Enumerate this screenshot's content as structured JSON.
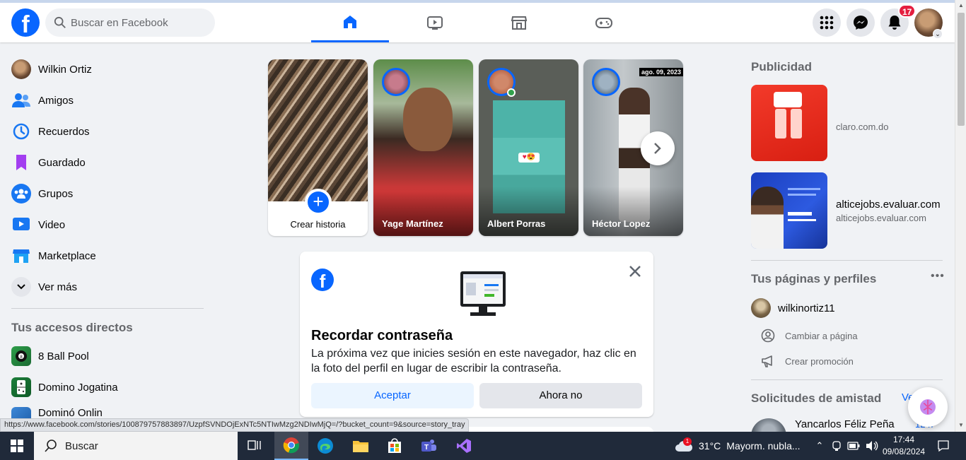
{
  "topbar": {
    "logo_letter": "f",
    "search_placeholder": "Buscar en Facebook",
    "notifications_count": "17",
    "nav_tabs": [
      "home-icon",
      "video-icon",
      "marketplace-icon",
      "gaming-icon"
    ],
    "right_buttons": [
      "menu-grid-icon",
      "messenger-icon",
      "bell-icon"
    ],
    "accent": "#0866ff"
  },
  "sidebar": {
    "items": [
      {
        "label": "Wilkin Ortiz",
        "icon": "profile-avatar"
      },
      {
        "label": "Amigos",
        "icon": "friends-icon"
      },
      {
        "label": "Recuerdos",
        "icon": "memories-clock-icon"
      },
      {
        "label": "Guardado",
        "icon": "bookmark-icon"
      },
      {
        "label": "Grupos",
        "icon": "groups-icon"
      },
      {
        "label": "Video",
        "icon": "video-icon"
      },
      {
        "label": "Marketplace",
        "icon": "marketplace-icon"
      },
      {
        "label": "Ver más",
        "icon": "chevron-down-icon"
      }
    ],
    "shortcuts_title": "Tus accesos directos",
    "shortcuts": [
      {
        "label": "8 Ball Pool",
        "icon": "8ball-app-icon"
      },
      {
        "label": "Domino Jogatina",
        "icon": "domino-app-icon"
      },
      {
        "label": "Dominó Onlin",
        "icon": "domino-online-app-icon"
      }
    ]
  },
  "stories": {
    "create_label": "Crear historia",
    "items": [
      {
        "name": "Yage Martínez"
      },
      {
        "name": "Albert Porras"
      },
      {
        "name": "Héctor Lopez",
        "date_tag": "ago. 09, 2023"
      }
    ]
  },
  "password_card": {
    "title": "Recordar contraseña",
    "description": "La próxima vez que inicies sesión en este navegador, haz clic en la foto del perfil en lugar de escribir la contraseña.",
    "accept_label": "Aceptar",
    "decline_label": "Ahora no"
  },
  "right_column": {
    "ads_title": "Publicidad",
    "ads": [
      {
        "domain": "claro.com.do",
        "headline": ""
      },
      {
        "domain": "alticejobs.evaluar.com",
        "headline": "alticejobs.evaluar.com"
      }
    ],
    "pages_title": "Tus páginas y perfiles",
    "page_name": "wilkinortiz11",
    "page_actions": [
      "Cambiar a página",
      "Crear promoción"
    ],
    "requests_title": "Solicitudes de amistad",
    "requests_link": "Ve",
    "request_name": "Yancarlos Féliz Peña",
    "request_time": "12 h"
  },
  "status_url": "https://www.facebook.com/stories/100879757883897/UzpfSVNDOjExNTc5NTIwMzg2NDIwMjQ=/?bucket_count=9&source=story_tray",
  "taskbar": {
    "search_label": "Buscar",
    "weather_temp": "31°C",
    "weather_desc": "Mayorm. nubla...",
    "weather_badge": "1",
    "time": "17:44",
    "date": "09/08/2024"
  }
}
